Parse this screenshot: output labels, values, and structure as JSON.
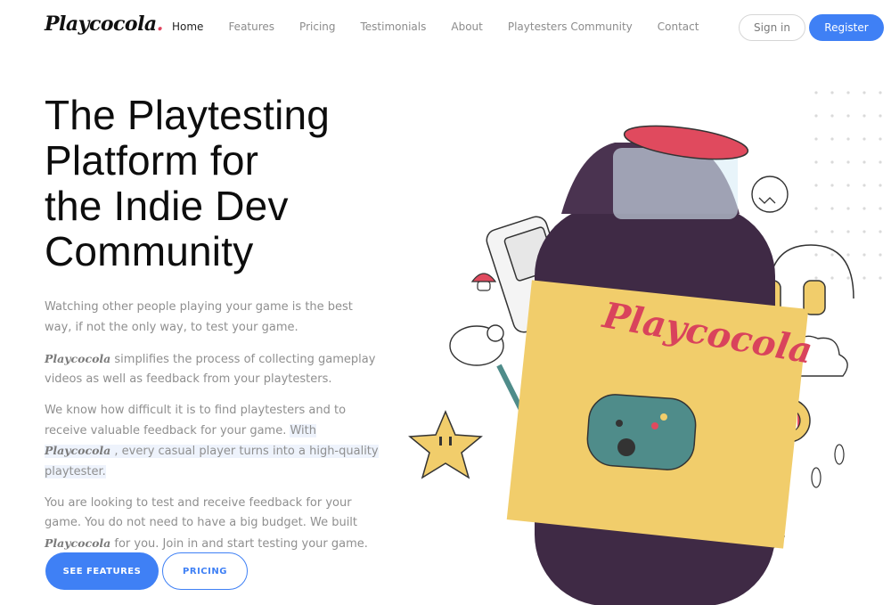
{
  "nav": {
    "logo": "Playcocola",
    "logo_dot": ".",
    "links": [
      "Home",
      "Features",
      "Pricing",
      "Testimonials",
      "About",
      "Playtesters Community",
      "Contact"
    ],
    "active": "Home",
    "signin_label": "Sign in",
    "register_label": "Register"
  },
  "hero": {
    "headline": [
      "The Playtesting",
      "Platform for",
      "the Indie Dev",
      "Community"
    ],
    "p1": "Watching other people playing your game is the best way, if not the only way, to test your game.",
    "p2_brand": "Playcocola",
    "p2_rest": " simplifies the process of collecting gameplay videos as well as feedback from your playtesters.",
    "p3_a": "We know how difficult it is to find playtesters and to receive valuable feedback for your game. ",
    "p3_hl_a": "With ",
    "p3_brand": "Playcocola",
    "p3_hl_b": " , every casual player turns into a high-quality playtester.",
    "p4_a": "You are looking to test and receive feedback for your game. You do not need to have a big budget. We built ",
    "p4_brand": "Playcocola",
    "p4_b": " for you. Join in and start testing your game.",
    "cta_primary": "SEE FEATURES",
    "cta_secondary": "PRICING"
  },
  "illustration": {
    "bottle_label": "Playcocola",
    "colors": {
      "bottle": "#3f2a45",
      "label": "#f1cd6b",
      "cap": "#e04a5e",
      "gamepad": "#4f8c8a",
      "accent": "#3f80f5"
    }
  }
}
